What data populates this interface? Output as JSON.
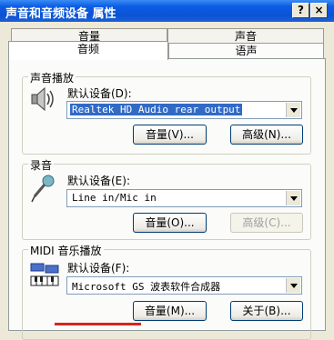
{
  "window": {
    "title": "声音和音频设备 属性",
    "help_label": "?",
    "close_label": "×"
  },
  "tabs": {
    "back": [
      "音量",
      "声音"
    ],
    "front": [
      "音频",
      "语声"
    ],
    "active": "音频"
  },
  "playback": {
    "group_label": "声音播放",
    "device_label": "默认设备(D):",
    "device_value": "Realtek HD Audio rear output",
    "volume_button": "音量(V)...",
    "advanced_button": "高级(N)..."
  },
  "recording": {
    "group_label": "录音",
    "device_label": "默认设备(E):",
    "device_value": "Line in/Mic in",
    "volume_button": "音量(O)...",
    "advanced_button": "高级(C)..."
  },
  "midi": {
    "group_label": "MIDI 音乐播放",
    "device_label": "默认设备(F):",
    "device_value": "Microsoft GS 波表软件合成器",
    "volume_button": "音量(M)...",
    "about_button": "关于(B)..."
  },
  "colors": {
    "titlebar": "#0b53d4",
    "selection": "#316ac5",
    "face": "#ece9d8"
  }
}
